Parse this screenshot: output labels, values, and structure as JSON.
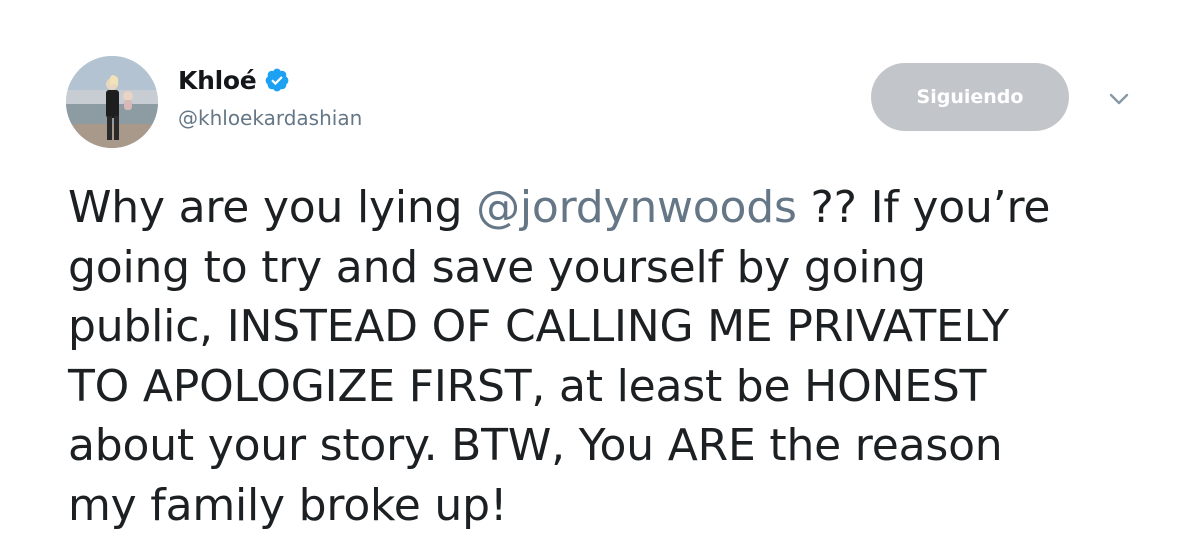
{
  "tweet": {
    "display_name": "Khloé",
    "verified": true,
    "handle": "@khloekardashian",
    "follow_button_label": "Siguiendo",
    "text_parts": {
      "line1_before": "Why are you lying ",
      "mention": "@jordynwoods",
      "line1_after": " ?? If you’re",
      "line2": "going to try and save yourself by going",
      "line3": "public, INSTEAD OF CALLING ME PRIVATELY",
      "line4": "TO APOLOGIZE FIRST, at least be HONEST",
      "line5": "about your story. BTW, You ARE the reason",
      "line6": "my family broke up!"
    }
  },
  "icons": {
    "verified": "verified-badge-icon",
    "menu": "chevron-down-icon"
  },
  "colors": {
    "verified_blue": "#1da1f2",
    "follow_button_bg": "#c2c6ca",
    "mention": "#657786",
    "text": "#1c2022",
    "handle": "#657786"
  }
}
